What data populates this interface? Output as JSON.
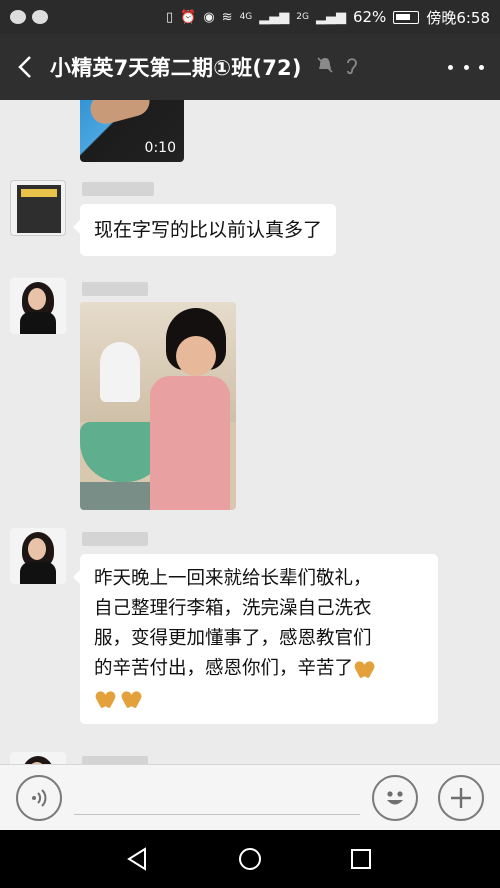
{
  "status_bar": {
    "battery": "62%",
    "network_4g": "4G",
    "network_2g": "2G",
    "time": "傍晚6:58"
  },
  "header": {
    "title": "小精英7天第二期①班(72)"
  },
  "messages": {
    "video_duration": "0:10",
    "text_1": "现在字写的比以前认真多了",
    "text_3_line1": "昨天晚上一回来就给长辈们敬礼，",
    "text_3_line2": "自己整理行李箱，洗完澡自己洗衣",
    "text_3_line3": "服，变得更加懂事了，感恩教官们",
    "text_3_line4": "的辛苦付出，感恩你们，辛苦了"
  },
  "icons": {
    "back": "chevron-left-icon",
    "mute": "bell-off-icon",
    "earpiece": "ear-icon",
    "more": "more-dots-icon",
    "voice": "voice-icon",
    "emoji": "emoji-icon",
    "add": "plus-icon",
    "clap_emoji": "clapping-hands-icon"
  }
}
